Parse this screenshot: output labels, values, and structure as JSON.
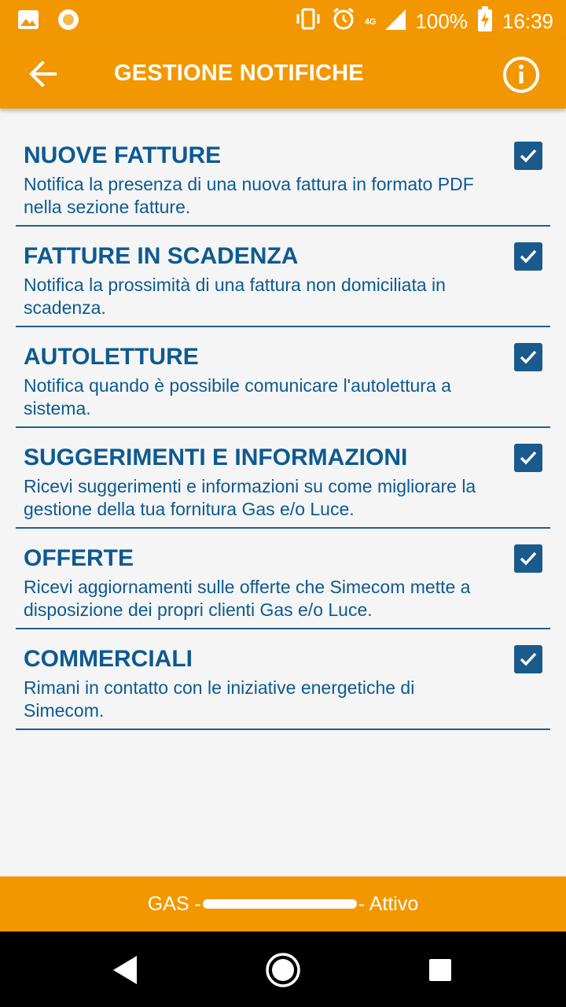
{
  "status_bar": {
    "network": "4G",
    "battery": "100%",
    "time": "16:39",
    "icons": [
      "image-icon",
      "circle-notification-icon",
      "vibrate-icon",
      "alarm-icon",
      "signal-icon",
      "battery-charging-icon"
    ]
  },
  "app_bar": {
    "title": "GESTIONE NOTIFICHE",
    "back_icon": "arrow-left-icon",
    "info_icon": "info-icon"
  },
  "notifications": [
    {
      "title": "NUOVE FATTURE",
      "description": "Notifica la presenza di una nuova fattura in formato PDF nella sezione fatture.",
      "checked": true
    },
    {
      "title": "FATTURE IN SCADENZA",
      "description": "Notifica la prossimità di una fattura non domiciliata in scadenza.",
      "checked": true
    },
    {
      "title": "AUTOLETTURE",
      "description": "Notifica quando è possibile comunicare l'autolettura a sistema.",
      "checked": true
    },
    {
      "title": "SUGGERIMENTI E INFORMAZIONI",
      "description": "Ricevi suggerimenti e informazioni su come migliorare la gestione della tua fornitura Gas e/o Luce.",
      "checked": true
    },
    {
      "title": "OFFERTE",
      "description": "Ricevi aggiornamenti sulle offerte che Simecom mette a disposizione dei propri clienti Gas e/o Luce.",
      "checked": true
    },
    {
      "title": "COMMERCIALI",
      "description": "Rimani in contatto con le iniziative energetiche di Simecom.",
      "checked": true
    }
  ],
  "footer": {
    "prefix": "GAS -",
    "suffix": "- Attivo"
  },
  "colors": {
    "primary": "#f29700",
    "text_blue": "#0d5a91",
    "checkbox_blue": "#1a5a8c"
  }
}
